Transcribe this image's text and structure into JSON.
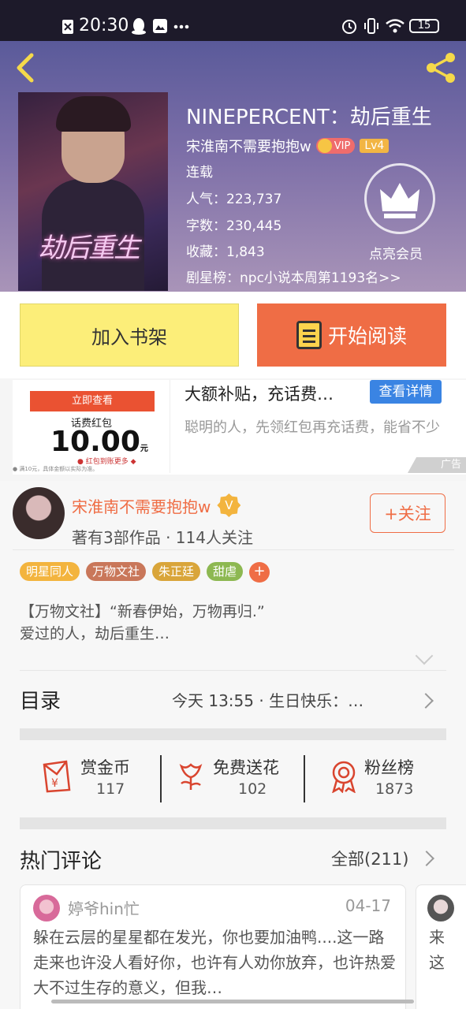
{
  "status_bar": {
    "time": "20:30",
    "battery": "15"
  },
  "book": {
    "title": "NINEPERCENT：劫后重生",
    "cover_title": "劫后重生",
    "author": "宋淮南不需要抱抱w",
    "vip": "VIP",
    "level": "Lv4",
    "status": "连载",
    "popularity": "人气：223,737",
    "word_count": "字数：230,445",
    "favorites": "收藏：1,843",
    "ranking": "剧星榜：npc小说本周第1193名>>",
    "member_label": "点亮会员"
  },
  "actions": {
    "add_shelf": "加入书架",
    "start_reading": "开始阅读"
  },
  "ad": {
    "image_button": "立即查看",
    "image_caption": "话费红包",
    "image_amount": "10.00",
    "image_unit": "元",
    "image_footer_red": "● 红包到账更多 ◆",
    "image_fine_print": "● 满10元，具体金额以实际为准。",
    "title": "大额补贴，充话费…",
    "detail_button": "查看详情",
    "description": "聪明的人，先领红包再充话费，能省不少",
    "ad_label": "广告"
  },
  "author_card": {
    "name": "宋淮南不需要抱抱w",
    "badge": "V",
    "stats": "著有3部作品 · 114人关注",
    "follow_button": "+关注"
  },
  "tags": [
    {
      "label": "明星同人",
      "color": "#f3b43e"
    },
    {
      "label": "万物文社",
      "color": "#c9775a"
    },
    {
      "label": "朱正廷",
      "color": "#d9a53a"
    },
    {
      "label": "甜虐",
      "color": "#8db851"
    }
  ],
  "tag_more": "+",
  "intro": "【万物文社】“新春伊始，万物再归.”\n爱过的人，劫后重生…",
  "toc": {
    "title": "目录",
    "latest": "今天 13:55 · 生日快乐：…"
  },
  "stats": {
    "coins_label": "赏金币",
    "coins_value": "117",
    "flowers_label": "免费送花",
    "flowers_value": "102",
    "fans_label": "粉丝榜",
    "fans_value": "1873"
  },
  "comments_section": {
    "title": "热门评论",
    "all": "全部(211)"
  },
  "comments": [
    {
      "user": "婷爷hin忙",
      "date": "04-17",
      "text": "躲在云层的星星都在发光，你也要加油鸭....这一路走来也许没人看好你，也许有人劝你放弃，也许热爱大不过生存的意义，但我…"
    },
    {
      "text": "来\n这"
    }
  ],
  "colors": {
    "accent": "#ef6d45",
    "shelf": "#fcee79",
    "link_blue": "#3a84e3"
  }
}
